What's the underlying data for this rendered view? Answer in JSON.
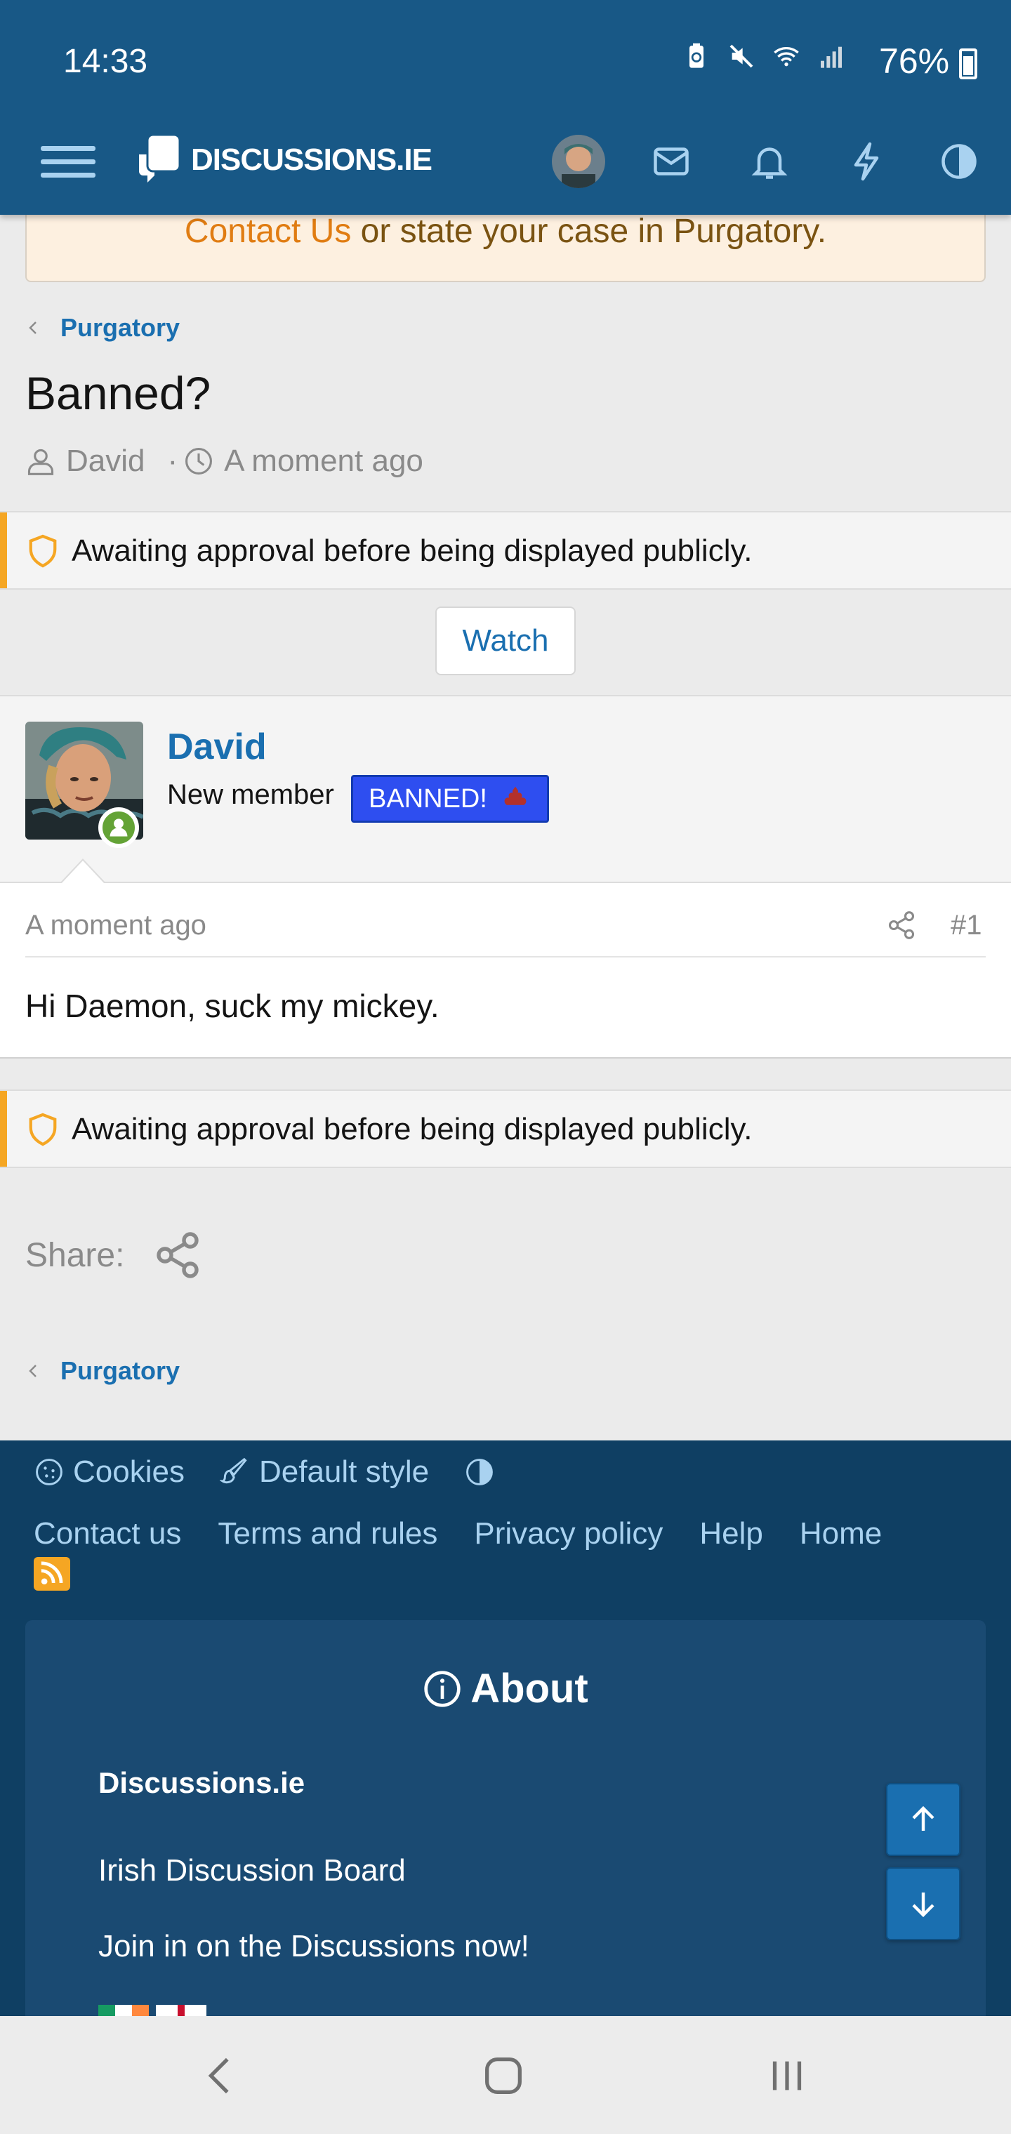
{
  "status_bar": {
    "time": "14:33",
    "battery": "76%"
  },
  "app_bar": {
    "logo_text": "DISCUSSIONS.IE"
  },
  "notice": {
    "link_text": "Contact Us",
    "rest_text": " or state your case in Purgatory."
  },
  "breadcrumb": {
    "label": "Purgatory"
  },
  "thread": {
    "title": "Banned?",
    "author": "David",
    "dot": "·",
    "time": "A moment ago"
  },
  "approval_notice": {
    "text": "Awaiting approval before being displayed publicly."
  },
  "watch_button": {
    "label": "Watch"
  },
  "user": {
    "name": "David",
    "title": "New member",
    "badge": "BANNED!"
  },
  "post": {
    "date": "A moment ago",
    "number": "#1",
    "body": "Hi Daemon, suck my mickey."
  },
  "share": {
    "label": "Share:"
  },
  "footer": {
    "row1": {
      "cookies": "Cookies",
      "style": "Default style"
    },
    "links": {
      "contact": "Contact us",
      "terms": "Terms and rules",
      "privacy": "Privacy policy",
      "help": "Help",
      "home": "Home"
    },
    "about": {
      "heading": "About",
      "site": "Discussions.ie",
      "line1": "Irish Discussion Board",
      "line2": "Join in on the Discussions now!"
    }
  },
  "colors": {
    "header_bg": "#185886",
    "link_blue": "#1a6fb0",
    "accent_orange": "#f5a623",
    "banned_badge": "#2e4ef0",
    "footer_bg": "#0f3f63",
    "online_green": "#64a336"
  },
  "icons": {
    "menu": "hamburger-icon",
    "messages": "envelope-icon",
    "alerts": "bell-icon",
    "whats_new": "bolt-icon",
    "theme": "contrast-icon",
    "share": "share-icon",
    "shield": "shield-icon",
    "clock": "clock-icon",
    "user": "user-icon",
    "info": "info-icon",
    "rss": "rss-icon"
  }
}
